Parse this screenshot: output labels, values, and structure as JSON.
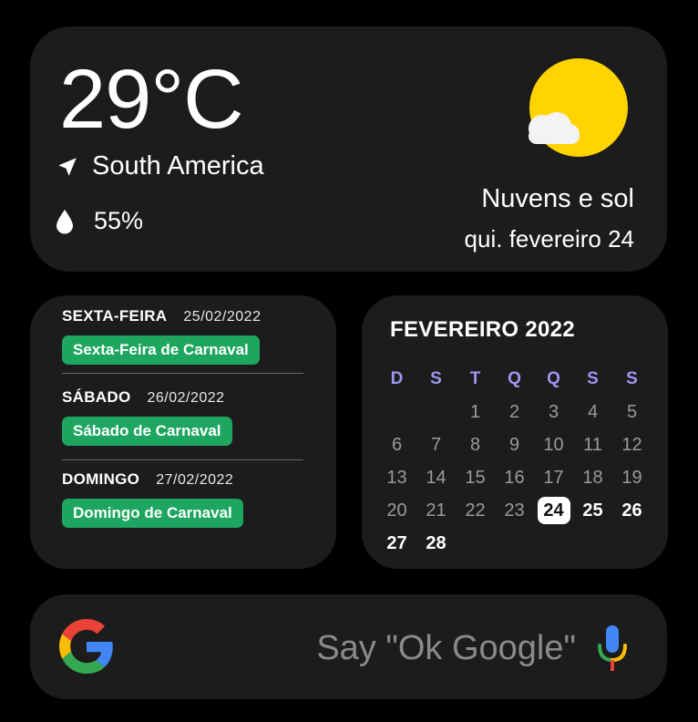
{
  "weather": {
    "temperature": "29°C",
    "location": "South America",
    "humidity": "55%",
    "condition": "Nuvens e sol",
    "date": "qui. fevereiro 24",
    "icon": "partly-sunny-icon"
  },
  "events": [
    {
      "day": "SEXTA-FEIRA",
      "date": "25/02/2022",
      "title": "Sexta-Feira de Carnaval"
    },
    {
      "day": "SÁBADO",
      "date": "26/02/2022",
      "title": "Sábado de Carnaval"
    },
    {
      "day": "DOMINGO",
      "date": "27/02/2022",
      "title": "Domingo de Carnaval"
    }
  ],
  "calendar": {
    "title": "FEVEREIRO 2022",
    "weekdays": [
      "D",
      "S",
      "T",
      "Q",
      "Q",
      "S",
      "S"
    ],
    "weeks": [
      [
        "",
        "",
        "1",
        "2",
        "3",
        "4",
        "5"
      ],
      [
        "6",
        "7",
        "8",
        "9",
        "10",
        "11",
        "12"
      ],
      [
        "13",
        "14",
        "15",
        "16",
        "17",
        "18",
        "19"
      ],
      [
        "20",
        "21",
        "22",
        "23",
        "24",
        "25",
        "26"
      ],
      [
        "27",
        "28",
        "",
        "",
        "",
        "",
        ""
      ]
    ],
    "today": "24"
  },
  "search": {
    "hint": "Say \"Ok Google\"",
    "brand_colors": {
      "blue": "#4285F4",
      "red": "#EA4335",
      "yellow": "#FBBC05",
      "green": "#34A853"
    }
  }
}
